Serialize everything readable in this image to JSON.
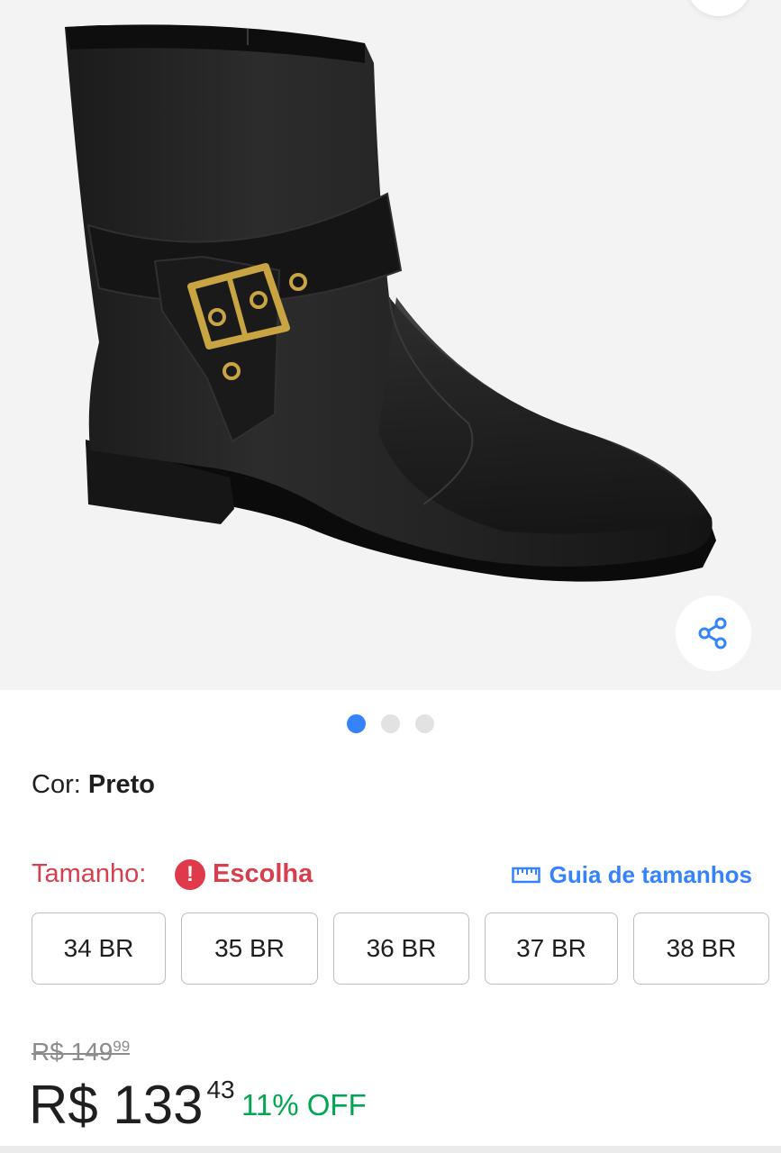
{
  "gallery": {
    "image_icon": "black-ankle-boot-with-gold-buckle",
    "share_icon": "share-icon",
    "dots_total": 3,
    "active_dot": 0,
    "active_color": "#3483fa"
  },
  "color": {
    "label": "Cor:",
    "value": "Preto"
  },
  "size": {
    "label": "Tamanho:",
    "status": "Escolha",
    "guide_label": "Guia de tamanhos",
    "options": [
      "34 BR",
      "35 BR",
      "36 BR",
      "37 BR",
      "38 BR"
    ]
  },
  "price": {
    "old_integer": "R$ 149",
    "old_cents": "99",
    "integer": "R$ 133",
    "cents": "43",
    "discount": "11% OFF",
    "discount_color": "#00a650"
  },
  "colors": {
    "error": "#d63f4d",
    "link": "#3483fa"
  }
}
